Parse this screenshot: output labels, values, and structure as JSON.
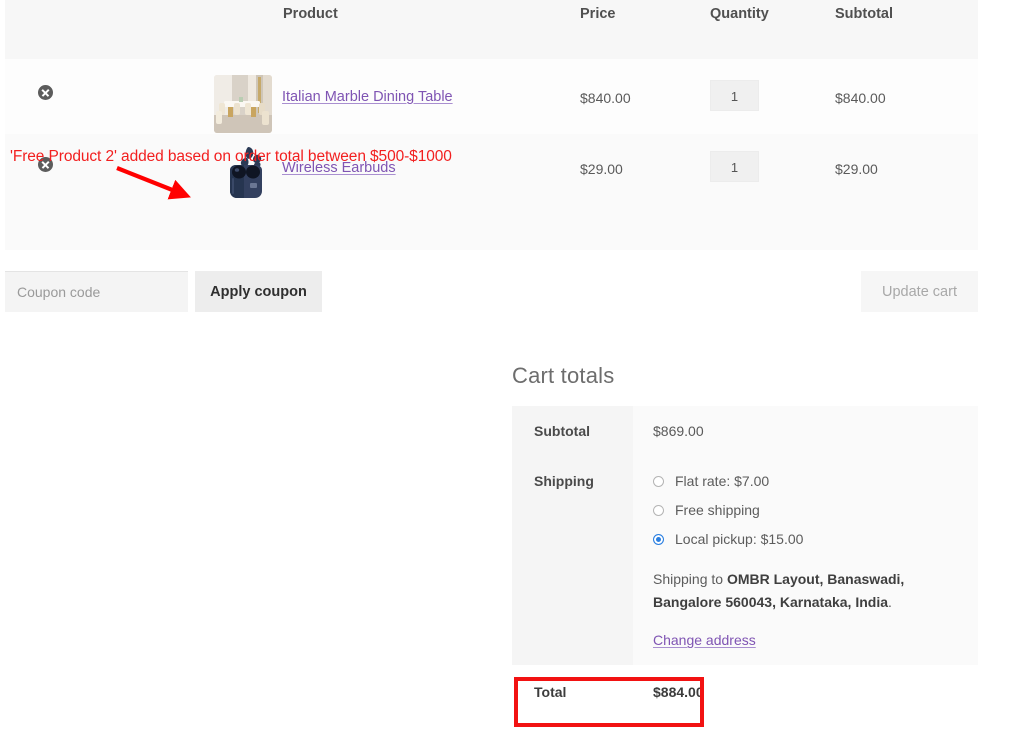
{
  "cart_table": {
    "columns": [
      "",
      "",
      "Product",
      "Price",
      "Quantity",
      "Subtotal"
    ],
    "headers": {
      "product": "Product",
      "price": "Price",
      "quantity": "Quantity",
      "subtotal": "Subtotal"
    },
    "rows": [
      {
        "remove_label": "×",
        "thumb_alt": "italian-marble-dining-table-thumbnail",
        "name": "Italian Marble Dining Table",
        "price": "$840.00",
        "quantity": "1",
        "subtotal": "$840.00"
      },
      {
        "remove_label": "×",
        "thumb_alt": "wireless-earbuds-thumbnail",
        "name": "Wireless Earbuds",
        "price": "$29.00",
        "quantity": "1",
        "subtotal": "$29.00"
      }
    ]
  },
  "coupon": {
    "placeholder": "Coupon code",
    "value": "",
    "apply_label": "Apply coupon",
    "update_cart_label": "Update cart"
  },
  "cart_totals": {
    "title": "Cart totals",
    "subtotal_label": "Subtotal",
    "subtotal_value": "$869.00",
    "shipping_label": "Shipping",
    "shipping_options": [
      {
        "label": "Flat rate: $7.00",
        "selected": false
      },
      {
        "label": "Free shipping",
        "selected": false
      },
      {
        "label": "Local pickup: $15.00",
        "selected": true
      }
    ],
    "shipping_to_prefix": "Shipping to ",
    "shipping_to_address": "OMBR Layout, Banaswadi, Bangalore 560043, Karnataka, India",
    "shipping_to_suffix": ".",
    "change_address_label": "Change address",
    "total_label": "Total",
    "total_value": "$884.00"
  },
  "annotations": {
    "free_product_note": "'Free Product 2' added based on order total between $500-$1000",
    "arrow_color": "#ff0000",
    "highlight_color": "#f21212"
  },
  "colors": {
    "link_purple": "#7f54b3",
    "annotation_red": "#f21f1f",
    "radio_blue": "#2b7fe0",
    "header_bg": "#f7f7f7"
  }
}
